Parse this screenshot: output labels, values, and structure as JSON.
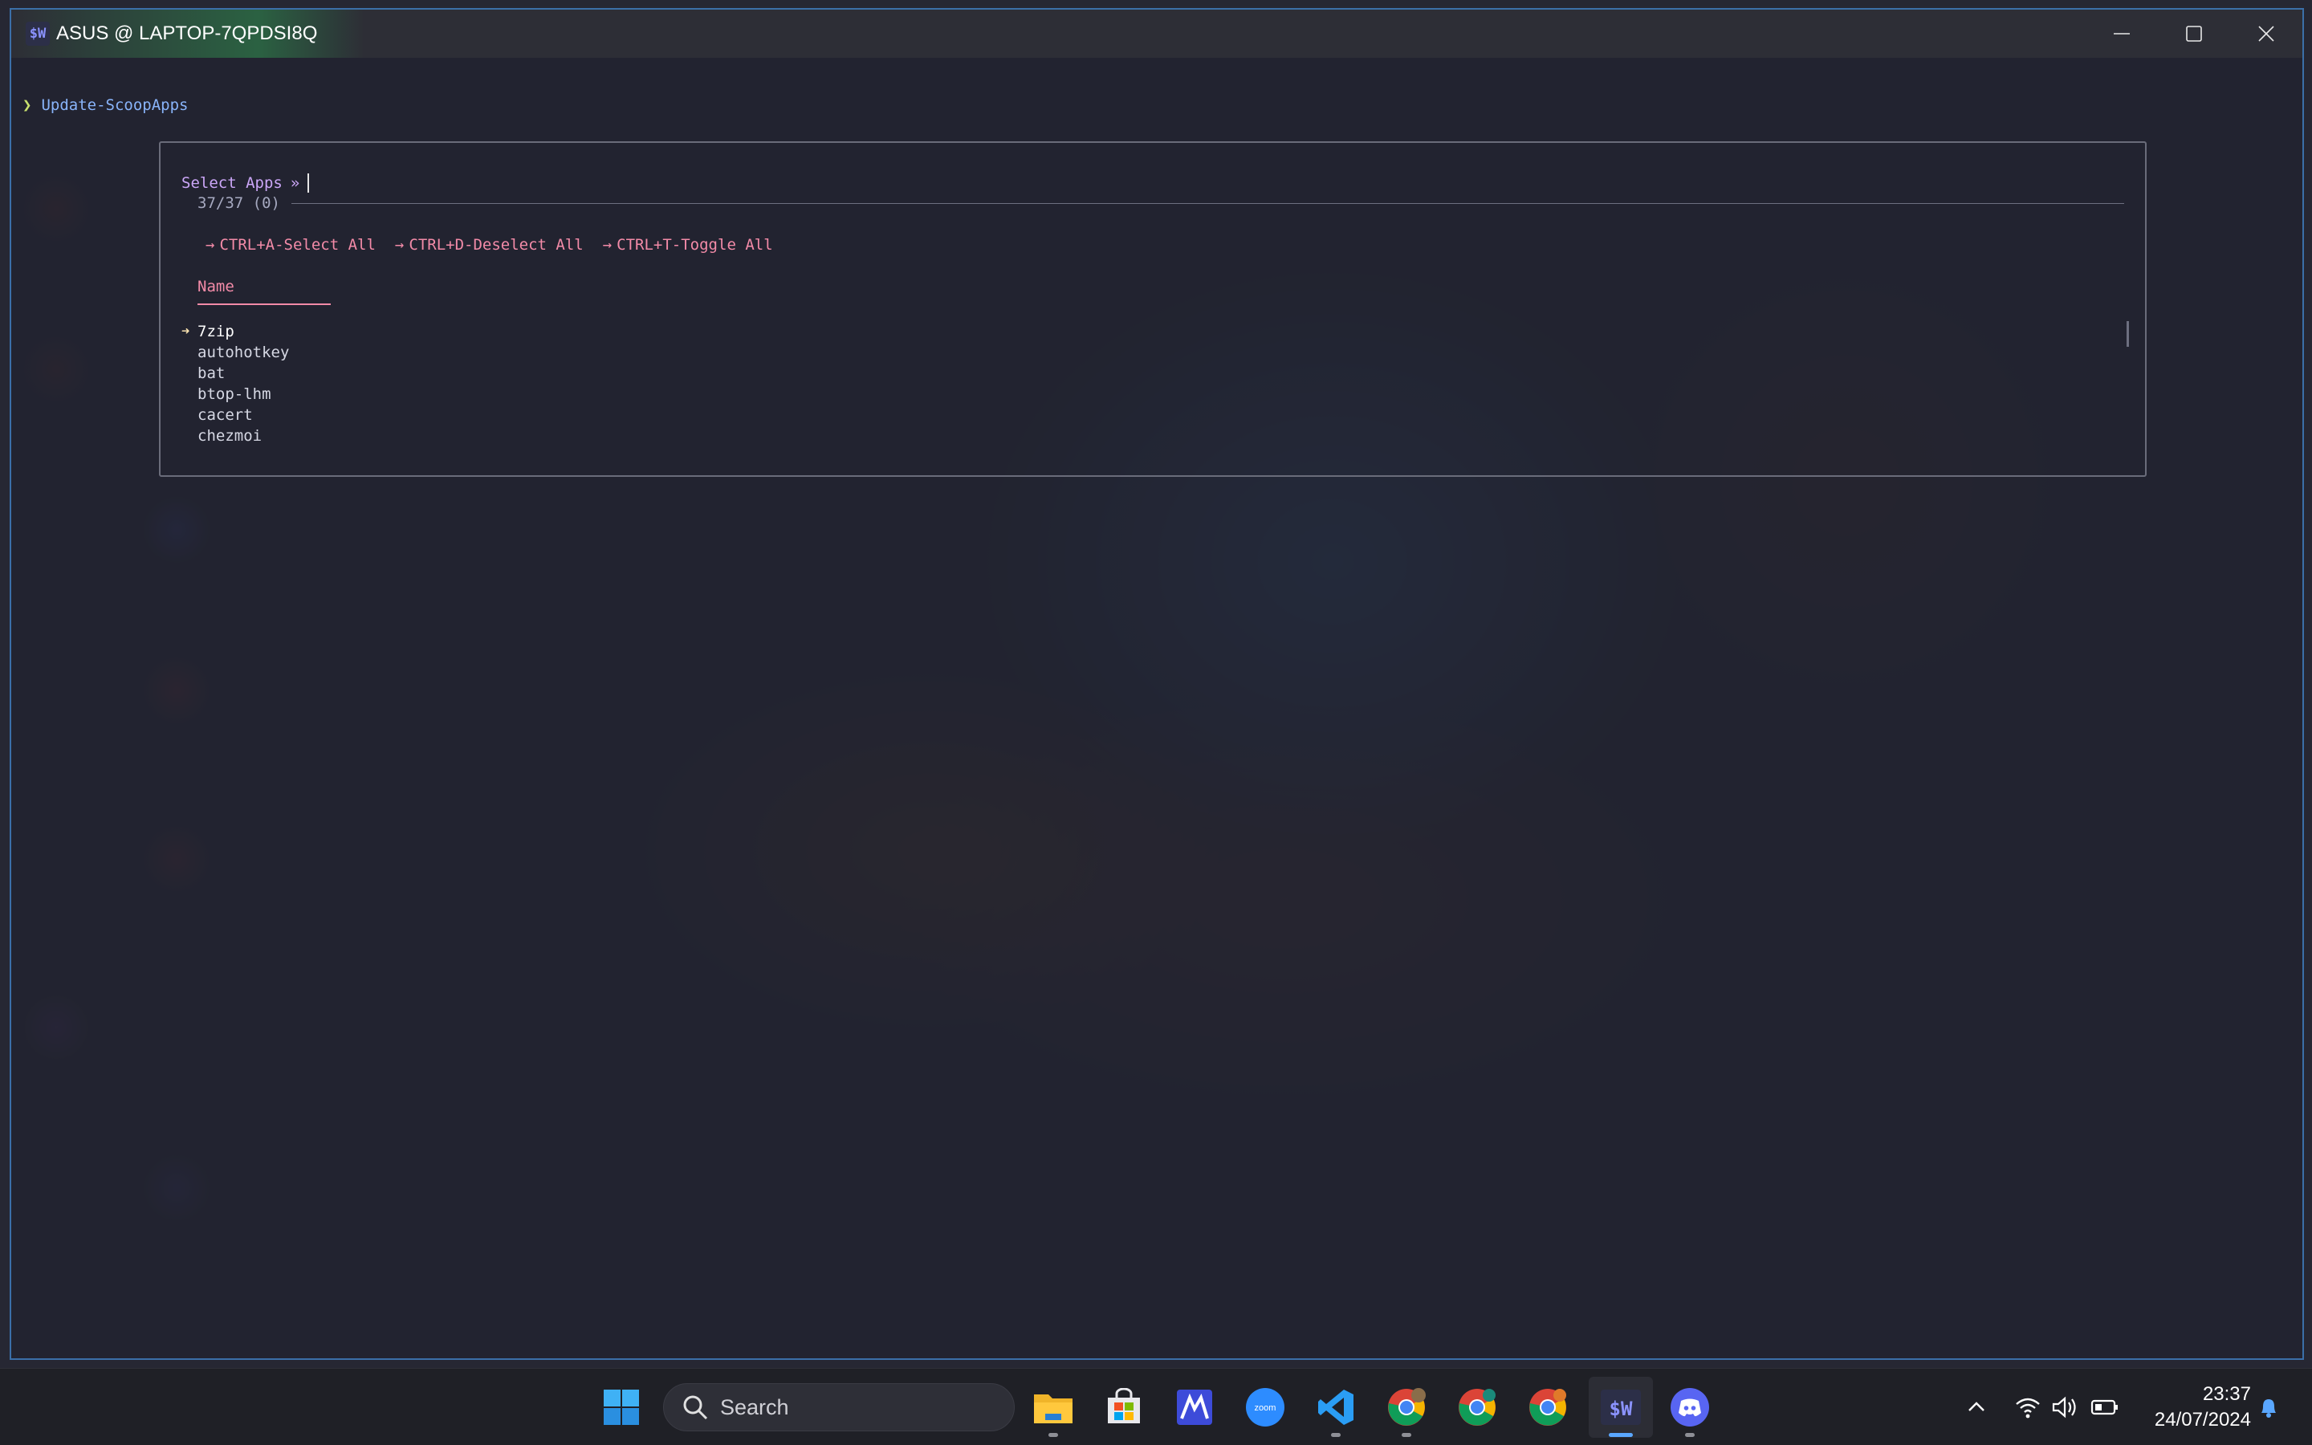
{
  "window": {
    "title": "ASUS @ LAPTOP-7QPDSI8Q",
    "app_icon_text": "$W"
  },
  "terminal": {
    "prompt_symbol": "❯",
    "command": "Update-ScoopApps",
    "selector": {
      "label": "Select Apps",
      "arrows": "»",
      "count": "37/37 (0)",
      "shortcuts": [
        {
          "arrow": "→",
          "text": "CTRL+A-Select All"
        },
        {
          "arrow": "→",
          "text": "CTRL+D-Deselect All"
        },
        {
          "arrow": "→",
          "text": "CTRL+T-Toggle All"
        }
      ],
      "column_header": "Name",
      "items": [
        {
          "name": "7zip",
          "marker": "➜"
        },
        {
          "name": "autohotkey",
          "marker": ""
        },
        {
          "name": "bat",
          "marker": ""
        },
        {
          "name": "btop-lhm",
          "marker": ""
        },
        {
          "name": "cacert",
          "marker": ""
        },
        {
          "name": "chezmoi",
          "marker": ""
        }
      ]
    }
  },
  "taskbar": {
    "search_placeholder": "Search",
    "apps": [
      "start-icon",
      "file-explorer-icon",
      "microsoft-store-icon",
      "app-m-icon",
      "zoom-icon",
      "vscode-icon",
      "chrome-profile-1-icon",
      "chrome-profile-2-icon",
      "chrome-profile-3-icon",
      "terminal-sw-icon",
      "discord-icon"
    ],
    "zoom_label": "zoom",
    "terminal_label": "$W",
    "clock_time": "23:37",
    "clock_date": "24/07/2024"
  },
  "colors": {
    "accent": "#5aa7ff",
    "selector_label": "#cba6f7",
    "shortcut": "#f38ba8",
    "prompt_command": "#89b4fa"
  }
}
